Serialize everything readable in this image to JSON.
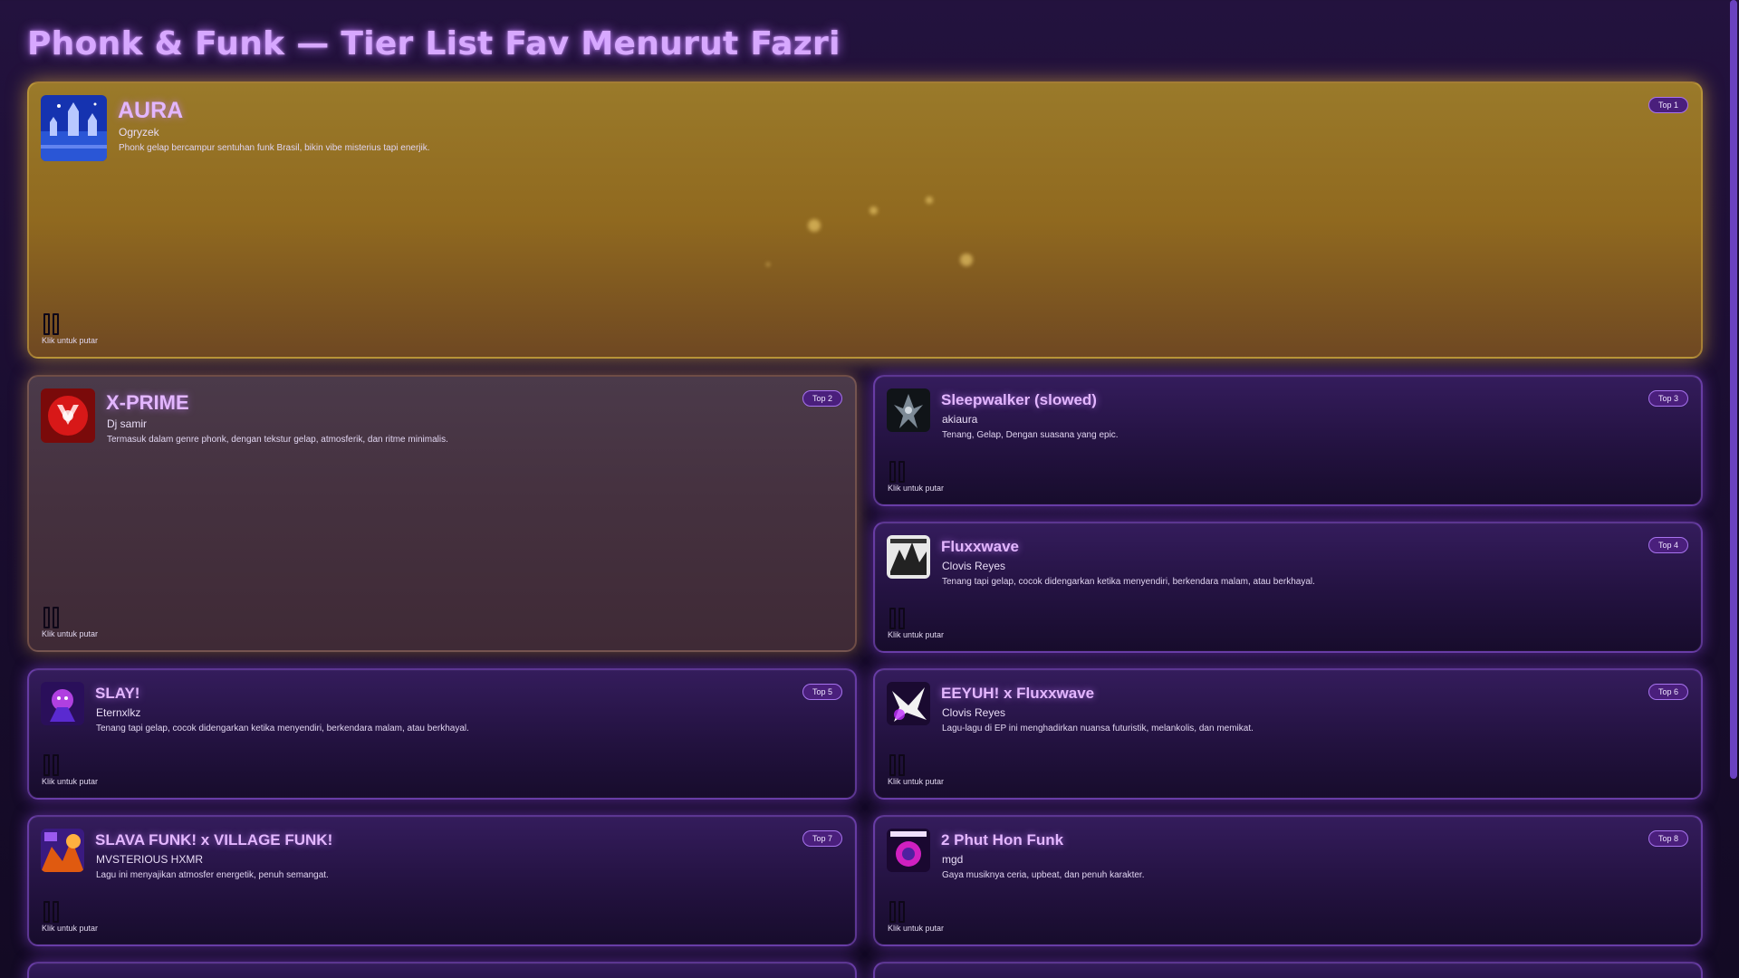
{
  "header": {
    "title": "Phonk & Funk — Tier List Fav Menurut Fazri"
  },
  "play_hint": "Klik untuk putar",
  "colors": {
    "accent": "#d7a8ff",
    "badge_bg": "#4a1f7c",
    "badge_border": "#a773ee",
    "gold_card": "#9a7a2a",
    "scrollbar": "#6a42c0"
  },
  "tracks": [
    {
      "rank": "Top 1",
      "title": "AURA",
      "artist": "Ogryzek",
      "description": "Phonk gelap bercampur sentuhan funk Brasil, bikin vibe misterius tapi enerjik."
    },
    {
      "rank": "Top 2",
      "title": "X-PRIME",
      "artist": "Dj samir",
      "description": "Termasuk dalam genre phonk, dengan tekstur gelap, atmosferik, dan ritme minimalis."
    },
    {
      "rank": "Top 3",
      "title": "Sleepwalker (slowed)",
      "artist": "akiaura",
      "description": "Tenang, Gelap, Dengan suasana yang epic."
    },
    {
      "rank": "Top 4",
      "title": "Fluxxwave",
      "artist": "Clovis Reyes",
      "description": "Tenang tapi gelap, cocok didengarkan ketika menyendiri, berkendara malam, atau berkhayal."
    },
    {
      "rank": "Top 5",
      "title": "SLAY!",
      "artist": "Eternxlkz",
      "description": "Tenang tapi gelap, cocok didengarkan ketika menyendiri, berkendara malam, atau berkhayal."
    },
    {
      "rank": "Top 6",
      "title": "EEYUH! x Fluxxwave",
      "artist": "Clovis Reyes",
      "description": "Lagu-lagu di EP ini menghadirkan nuansa futuristik, melankolis, dan memikat."
    },
    {
      "rank": "Top 7",
      "title": "SLAVA FUNK! x VILLAGE FUNK!",
      "artist": "MVSTERIOUS HXMR",
      "description": "Lagu ini menyajikan atmosfer energetik, penuh semangat."
    },
    {
      "rank": "Top 8",
      "title": "2 Phut Hon Funk",
      "artist": "mgd",
      "description": "Gaya musiknya ceria, upbeat, dan penuh karakter."
    }
  ]
}
